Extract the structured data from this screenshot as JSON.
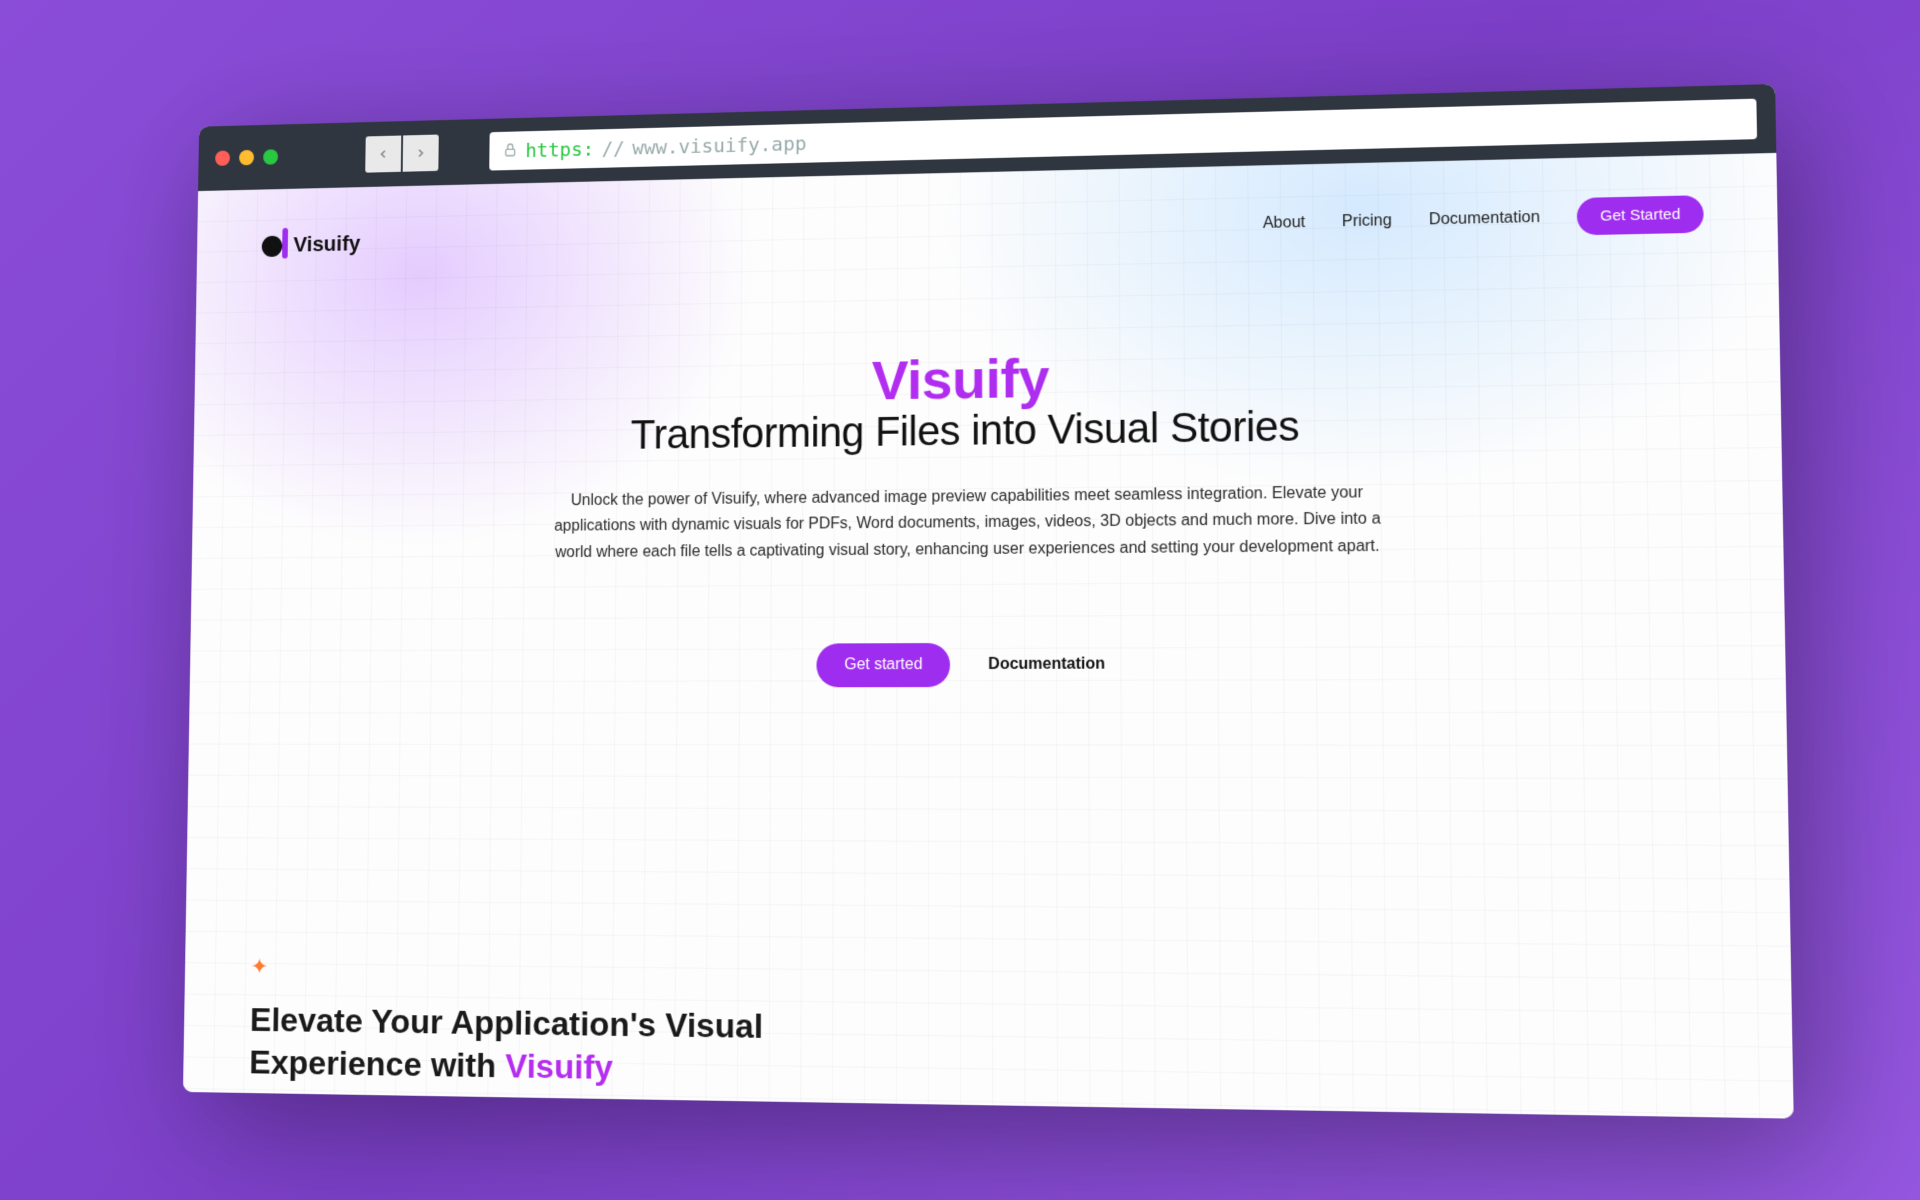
{
  "browser": {
    "url_proto": "https:",
    "url_sep": "//",
    "url_host": "www.visuify.app"
  },
  "nav": {
    "brand": "Visuify",
    "links": [
      "About",
      "Pricing",
      "Documentation"
    ],
    "cta": "Get Started"
  },
  "hero": {
    "title": "Visuify",
    "subtitle": "Transforming Files into Visual Stories",
    "description": "Unlock the power of Visuify, where advanced image preview capabilities meet seamless integration. Elevate your applications with dynamic visuals for PDFs, Word documents, images, videos, 3D objects and much more. Dive into a world where each file tells a captivating visual story, enhancing user experiences and setting your development apart.",
    "cta_primary": "Get started",
    "cta_secondary": "Documentation"
  },
  "section2": {
    "line1": "Elevate Your Application's Visual",
    "line2_pre": "Experience with ",
    "line2_accent": "Visuify"
  }
}
